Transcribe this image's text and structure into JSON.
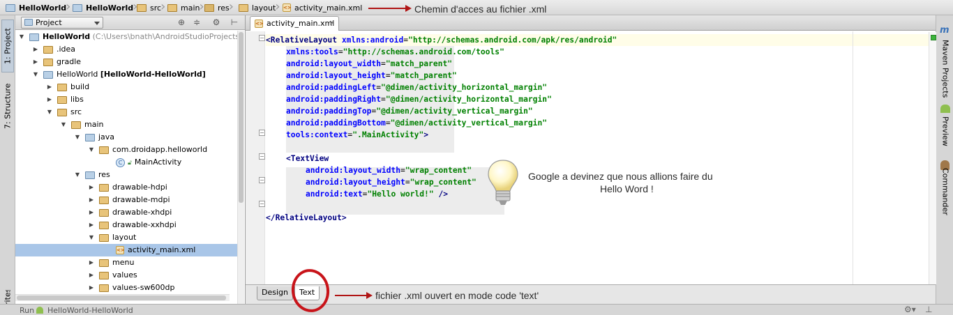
{
  "breadcrumbs": [
    "HelloWorld",
    "HelloWorld",
    "src",
    "main",
    "res",
    "layout",
    "activity_main.xml"
  ],
  "annotations": {
    "top": "Chemin d'acces au fichier .xml",
    "bulb_line1": "Google a devinez que nous allions faire du",
    "bulb_line2": "Hello Word !",
    "bottom": "fichier .xml ouvert en mode code 'text'"
  },
  "left_tabs": {
    "project": "1: Project",
    "structure": "7: Structure",
    "favorites": "rites"
  },
  "right_tabs": {
    "maven": "Maven Projects",
    "preview": "Preview",
    "commander": "Commander"
  },
  "project_panel": {
    "selector": "Project"
  },
  "tree": [
    {
      "label": "HelloWorld",
      "extra": "(C:\\Users\\bnath\\AndroidStudioProjects\\Hello"
    },
    {
      "label": ".idea"
    },
    {
      "label": "gradle"
    },
    {
      "label": "HelloWorld",
      "extra": "[HelloWorld-HelloWorld]"
    },
    {
      "label": "build"
    },
    {
      "label": "libs"
    },
    {
      "label": "src"
    },
    {
      "label": "main"
    },
    {
      "label": "java"
    },
    {
      "label": "com.droidapp.helloworld"
    },
    {
      "label": "MainActivity"
    },
    {
      "label": "res"
    },
    {
      "label": "drawable-hdpi"
    },
    {
      "label": "drawable-mdpi"
    },
    {
      "label": "drawable-xhdpi"
    },
    {
      "label": "drawable-xxhdpi"
    },
    {
      "label": "layout"
    },
    {
      "label": "activity_main.xml"
    },
    {
      "label": "menu"
    },
    {
      "label": "values"
    },
    {
      "label": "values-sw600dp"
    }
  ],
  "editor": {
    "file_tab": "activity_main.xml",
    "mode_tabs": [
      "Design",
      "Text"
    ],
    "active_mode": "Text"
  },
  "code": {
    "l1": [
      "<RelativeLayout",
      " xmlns:android",
      "=",
      "\"http://schemas.android.com/apk/res/android\""
    ],
    "l2": [
      "xmlns:tools",
      "=",
      "\"http://schemas.android.com/tools\""
    ],
    "l3": [
      "android:layout_width",
      "=",
      "\"match_parent\""
    ],
    "l4": [
      "android:layout_height",
      "=",
      "\"match_parent\""
    ],
    "l5": [
      "android:paddingLeft",
      "=",
      "\"@dimen/activity_horizontal_margin\""
    ],
    "l6": [
      "android:paddingRight",
      "=",
      "\"@dimen/activity_horizontal_margin\""
    ],
    "l7": [
      "android:paddingTop",
      "=",
      "\"@dimen/activity_vertical_margin\""
    ],
    "l8": [
      "android:paddingBottom",
      "=",
      "\"@dimen/activity_vertical_margin\""
    ],
    "l9": [
      "tools:context",
      "=",
      "\".MainActivity\"",
      ">"
    ],
    "l11": [
      "<TextView"
    ],
    "l12": [
      "android:layout_width",
      "=",
      "\"wrap_content\""
    ],
    "l13": [
      "android:layout_height",
      "=",
      "\"wrap_content\""
    ],
    "l14": [
      "android:text",
      "=",
      "\"Hello world!\"",
      " />"
    ],
    "l16": [
      "</RelativeLayout>"
    ]
  },
  "status": {
    "run": "Run",
    "config": "HelloWorld-HelloWorld"
  },
  "colors": {
    "annotation_red": "#b01414",
    "selection": "#a9c6e8",
    "tag": "#000080",
    "value": "#008000"
  }
}
